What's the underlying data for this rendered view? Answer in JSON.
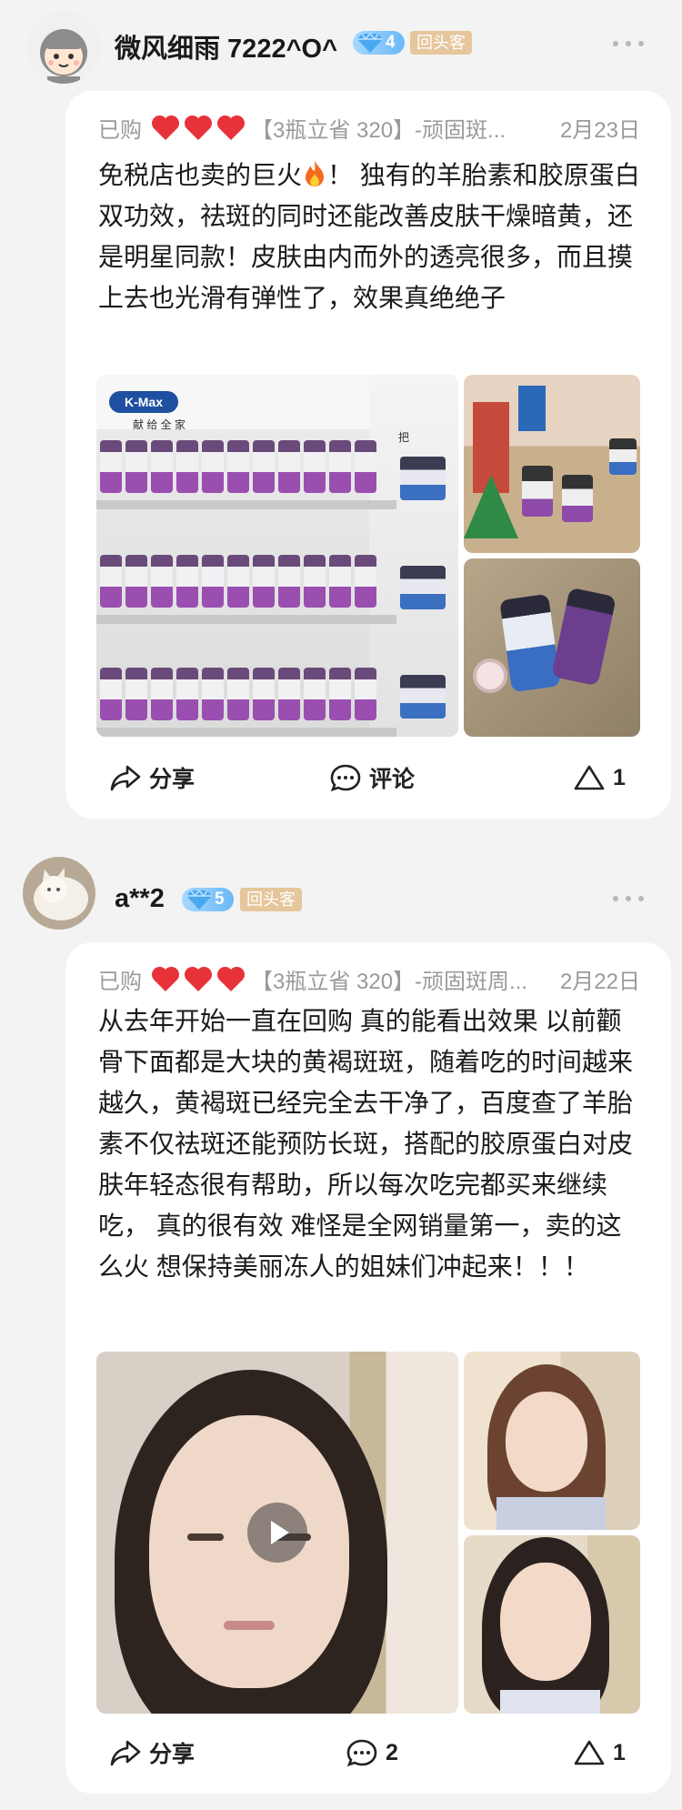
{
  "reviews": [
    {
      "username": "微风细雨 7222^O^",
      "vip_level": "4",
      "badge": "回头客",
      "bought_label": "已购",
      "spec": "【3瓶立省 320】-顽固斑...",
      "date": "2月23日",
      "text_before_icon": "免税店也卖的巨火",
      "text_after_icon": "！ 独有的羊胎素和胶原蛋白双功效，祛斑的同时还能改善皮肤干燥暗黄，还是明星同款！皮肤由内而外的透亮很多，而且摸上去也光滑有弹性了，效果真绝绝子",
      "shelf_logo": "K-Max",
      "shelf_sign": "献 给 全 家",
      "shelf_sign_2": "把",
      "share_label": "分享",
      "comment_label": "评论",
      "like_count": "1"
    },
    {
      "username": "a**2",
      "vip_level": "5",
      "badge": "回头客",
      "bought_label": "已购",
      "spec": "【3瓶立省 320】-顽固斑周...",
      "date": "2月22日",
      "text": "从去年开始一直在回购 真的能看出效果 以前颧骨下面都是大块的黄褐斑斑，随着吃的时间越来越久，黄褐斑已经完全去干净了，百度查了羊胎素不仅祛斑还能预防长斑，搭配的胶原蛋白对皮肤年轻态很有帮助，所以每次吃完都买来继续吃， 真的很有效 难怪是全网销量第一，卖的这么火 想保持美丽冻人的姐妹们冲起来！！！",
      "share_label": "分享",
      "comment_count": "2",
      "like_count": "1"
    }
  ],
  "colors": {
    "heart": "#e8323a",
    "badge_bg": "#e6c69c",
    "meta_gray": "#9a9a9a"
  }
}
